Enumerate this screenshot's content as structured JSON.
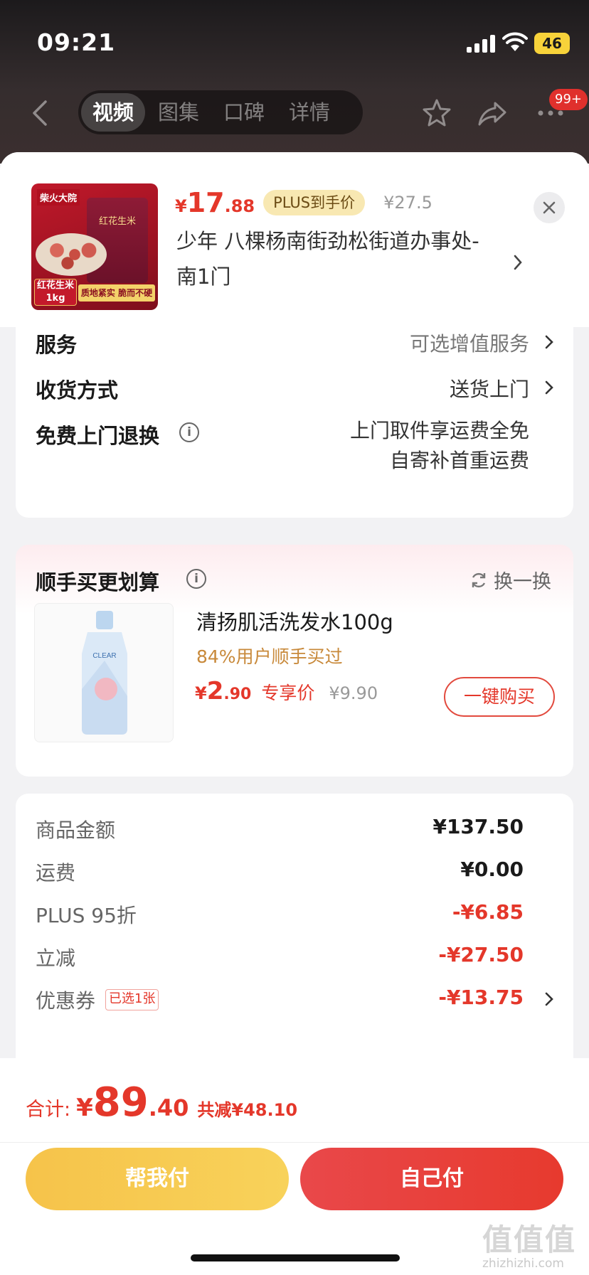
{
  "status_bar": {
    "time": "09:21",
    "battery": "46"
  },
  "nav": {
    "tabs": [
      "视频",
      "图集",
      "口碑",
      "详情"
    ],
    "active_tab": 0,
    "cart_badge": "99+"
  },
  "product": {
    "image_texts": {
      "brand": "柴火大院",
      "bag_text": "红花生米",
      "left_tag": "红花生米 1kg",
      "right_tag": "质地紧实 脆而不硬"
    },
    "price_currency": "¥",
    "price_int": "17",
    "price_dec": ".88",
    "plus_label": "PLUS到手价",
    "original_price": "¥27.5",
    "address": "少年  八棵杨南街劲松街道办事处-南1门"
  },
  "options": {
    "service_label": "服务",
    "service_value": "可选增值服务",
    "delivery_label": "收货方式",
    "delivery_value": "送货上门",
    "return_label": "免费上门退换",
    "return_value_line1": "上门取件享运费全免",
    "return_value_line2": "自寄补首重运费"
  },
  "upsell": {
    "title": "顺手买更划算",
    "refresh_label": "换一换",
    "product_brand": "CLEAR",
    "product_name": "清扬肌活洗发水100g",
    "bought_text": "84%用户顺手买过",
    "price_currency": "¥",
    "price_int": "2",
    "price_dec": ".90",
    "price_label": "专享价",
    "original_price": "¥9.90",
    "buy_button": "一键购买"
  },
  "fees": [
    {
      "label": "商品金额",
      "value": "¥137.50",
      "negative": false
    },
    {
      "label": "运费",
      "value": "¥0.00",
      "negative": false
    },
    {
      "label": "PLUS 95折",
      "value": "-¥6.85",
      "negative": true
    },
    {
      "label": "立减",
      "value": "-¥27.50",
      "negative": true
    },
    {
      "label": "优惠券",
      "value": "-¥13.75",
      "negative": true,
      "tag": "已选1张"
    }
  ],
  "summary": {
    "total_label": "合计:",
    "currency": "¥",
    "total_int": "89",
    "total_dec": ".40",
    "saved": "共减¥48.10",
    "pay_friend_label": "帮我付",
    "pay_self_label": "自己付"
  },
  "watermark": {
    "big": "值值值",
    "small": "zhizhizhi.com"
  },
  "colors": {
    "accent": "#e4372a",
    "gold": "#f6c34a",
    "upsell_orange": "#c8893a"
  }
}
